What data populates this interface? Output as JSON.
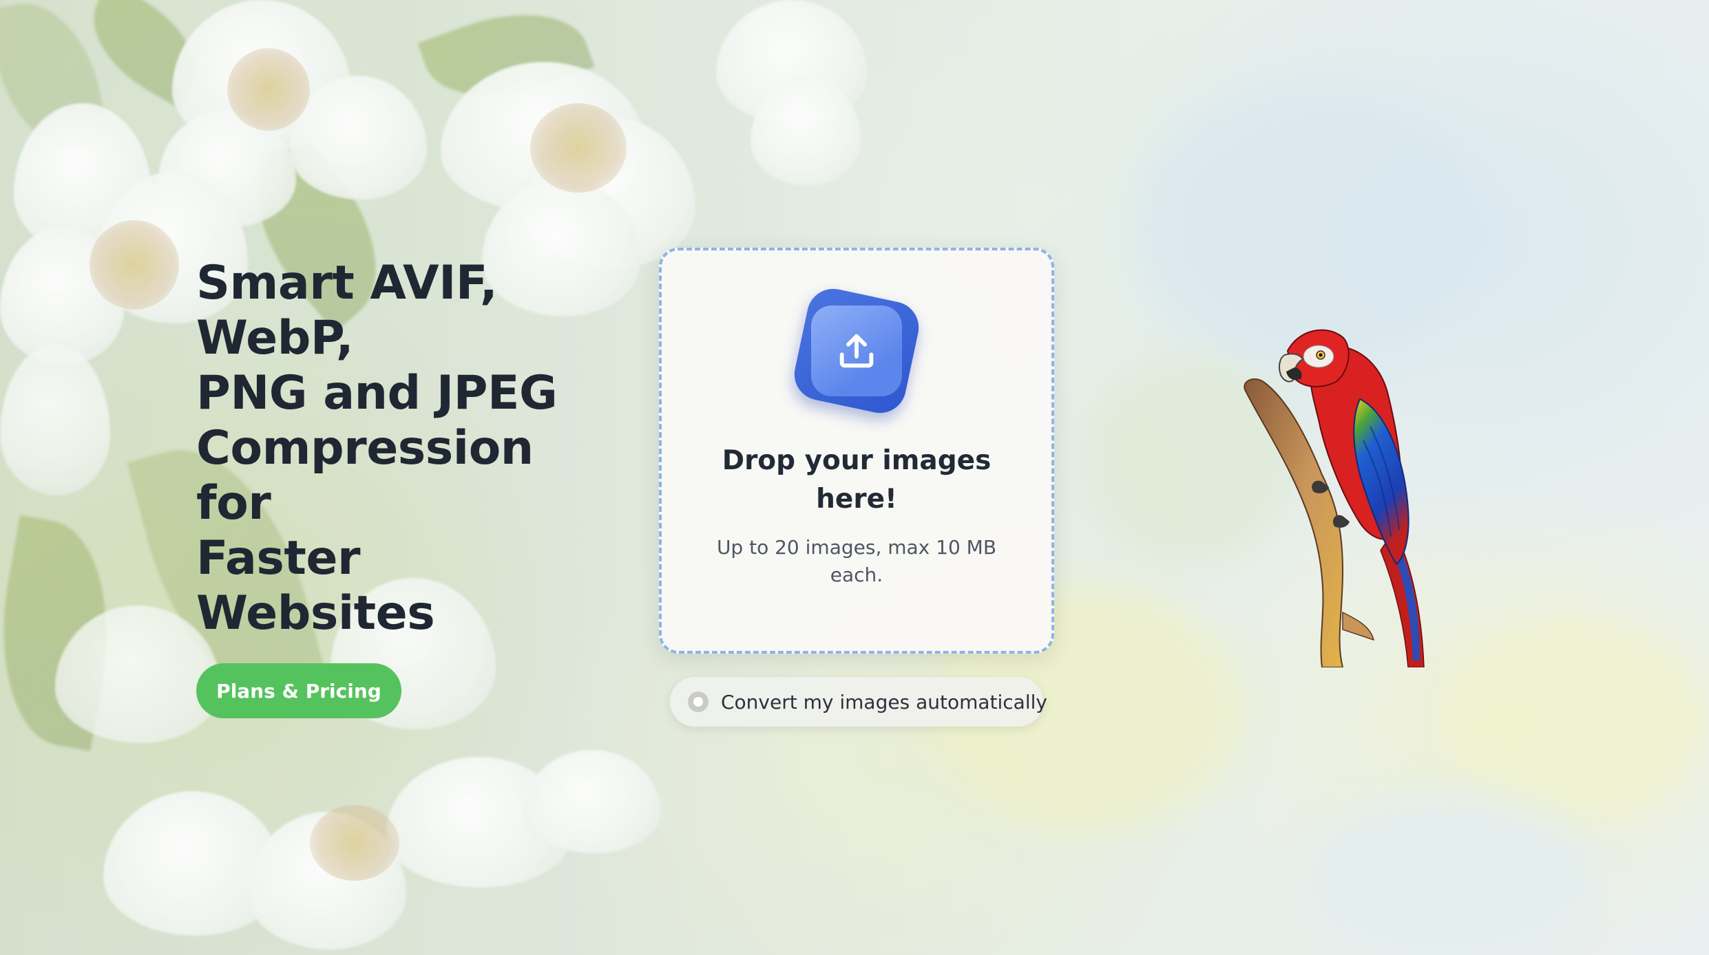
{
  "hero": {
    "title_lines": [
      "Smart AVIF,",
      "WebP,",
      "PNG and JPEG",
      "Compression",
      "for",
      "Faster",
      "Websites"
    ],
    "cta_label": "Plans & Pricing"
  },
  "dropzone": {
    "icon": "upload-icon",
    "title": "Drop your images here!",
    "subtitle": "Up to 20 images, max 10 MB each."
  },
  "auto_convert": {
    "label": "Convert my images automatically",
    "checked": false
  },
  "colors": {
    "cta": "#55c35d",
    "upload_icon": "#3f68d8",
    "dropzone_border": "#8db4e6",
    "heading_text": "#1f2733"
  }
}
